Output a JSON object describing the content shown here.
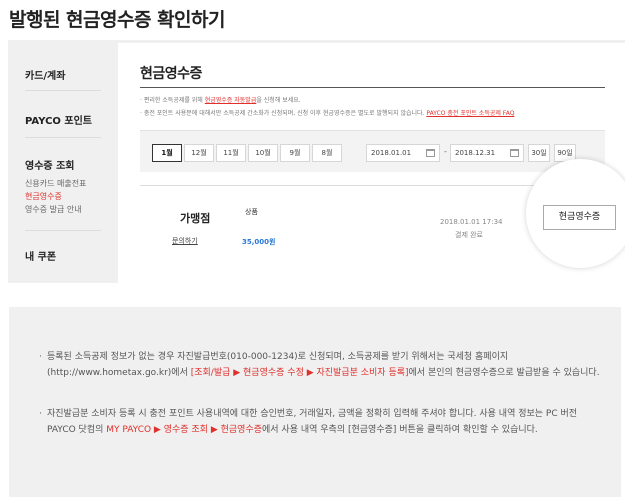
{
  "page_title": "발행된 현금영수증 확인하기",
  "sidebar": {
    "card_account": "카드/계좌",
    "payco_point": "PAYCO 포인트",
    "receipt_lookup": "영수증 조회",
    "sub": [
      "신용카드 매출전표",
      "현금영수증",
      "영수증 발급 안내"
    ],
    "my_coupon": "내 쿠폰"
  },
  "content": {
    "title": "현금영수증",
    "note1_pre": "· 편리한 소득공제를 위해 ",
    "note1_link": "현금영수증 자동발급",
    "note1_post": "을 신청해 보세요.",
    "note2_pre": "· 충전 포인트 사용분에 대해서만 소득공제 간소화가 신청되며, 신청 이후 현금영수증은 별도로 발행되지 않습니다. ",
    "note2_link": "PAYCO 충전 포인트 소득공제 FAQ"
  },
  "filter": {
    "months": [
      "1월",
      "12월",
      "11월",
      "10월",
      "9월",
      "8월"
    ],
    "active_month": "1월",
    "start_date": "2018.01.01",
    "end_date": "2018.12.31",
    "range_buttons": [
      "30일",
      "90일"
    ]
  },
  "result": {
    "merchant_label": "가맹점",
    "inquire_link": "문의하기",
    "goods_label": "상품",
    "amount": "35,000원",
    "datetime": "2018.01.01 17:34",
    "status": "결제 완료",
    "receipt_button": "현금영수증"
  },
  "info": {
    "bullet1_pre": "등록된 소득공제 정보가 없는 경우 자진발급번호(010-000-1234)로 신청되며, 소득공제를 받기 위해서는 국세청 홈페이지 (http://www.hometax.go.kr)에서 ",
    "bullet1_red": "[조회/발급 ▶ 현금영수증 수정 ▶ 자진발급분 소비자 등록]",
    "bullet1_post": "에서 본인의 현금영수증으로 발급받을 수 있습니다.",
    "bullet2_pre": "자진발급분 소비자 등록 시 충전 포인트 사용내역에 대한 승인번호, 거래일자, 금액을 정확히 입력해 주셔야 합니다. 사용 내역 정보는 PC 버전 PAYCO 닷컴의 ",
    "bullet2_red": "MY PAYCO ▶ 영수증 조회 ▶ 현금영수증",
    "bullet2_post": "에서 사용 내역 우측의 [현금영수증] 버튼을 클릭하여 확인할 수 있습니다."
  },
  "colors": {
    "accent_red": "#e0302c",
    "amount_blue": "#2a7ad5"
  }
}
